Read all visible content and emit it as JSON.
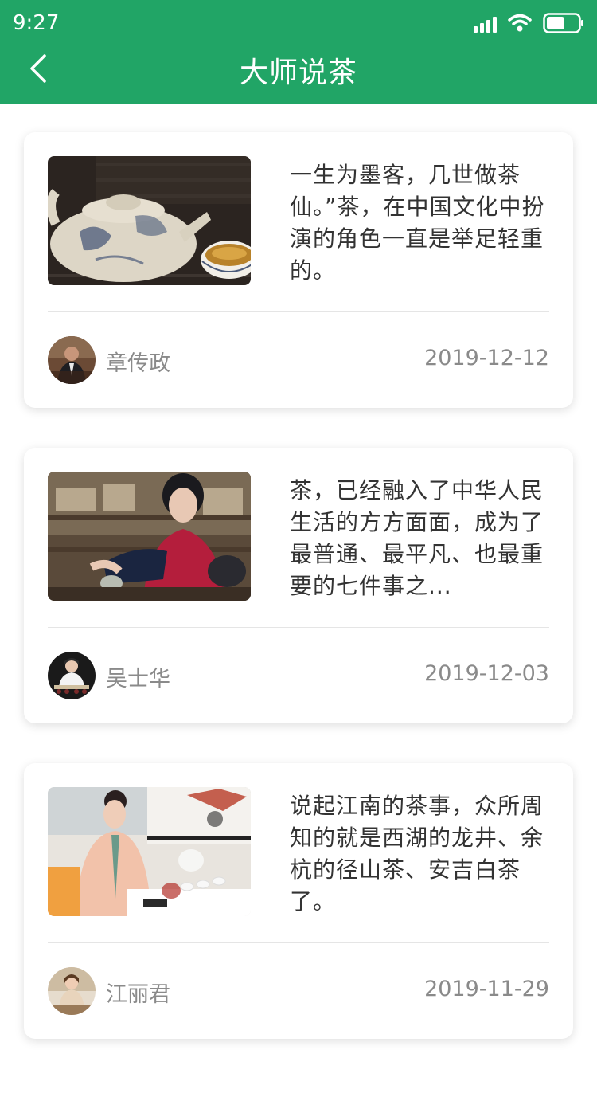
{
  "status_bar": {
    "time": "9:27"
  },
  "header": {
    "title": "大师说茶"
  },
  "articles": [
    {
      "excerpt": "一生为墨客，几世做茶仙。”茶，在中国文化中扮演的角色一直是举足轻重的。",
      "author": "章传政",
      "date": "2019-12-12"
    },
    {
      "excerpt": "茶，已经融入了中华人民生活的方方面面，成为了最普通、最平凡、也最重要的七件事之...",
      "author": "吴士华",
      "date": "2019-12-03"
    },
    {
      "excerpt": "说起江南的茶事，众所周知的就是西湖的龙井、余杭的径山茶、安吉白茶了。",
      "author": "江丽君",
      "date": "2019-11-29"
    }
  ]
}
